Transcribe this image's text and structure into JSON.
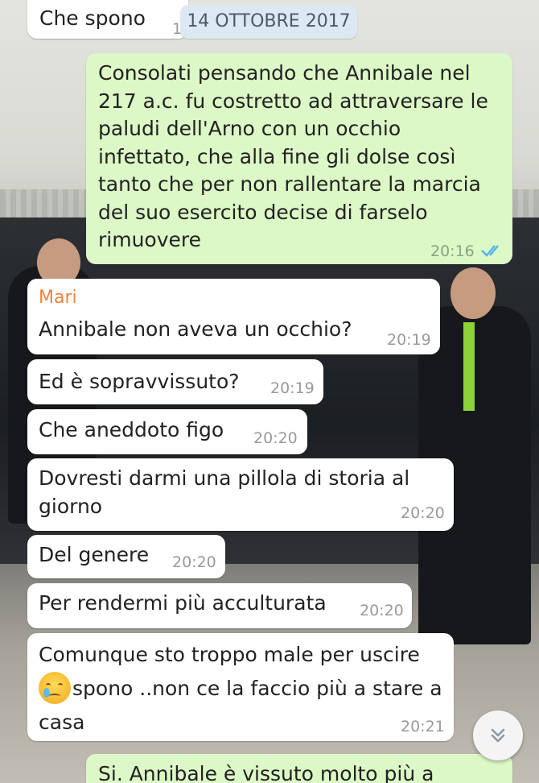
{
  "date_chip": "14 OTTOBRE 2017",
  "messages": [
    {
      "type": "in",
      "text": "Che spono",
      "time": "1"
    },
    {
      "type": "out",
      "text": "Consolati pensando che Annibale nel 217 a.c. fu costretto ad attraversare le paludi dell'Arno con un occhio infettato, che alla fine gli dolse così tanto che per non rallentare la marcia del suo esercito decise di farselo rimuovere",
      "time": "20:16",
      "status": "read-double-check"
    },
    {
      "type": "in",
      "sender": "Mari",
      "text": "Annibale non aveva un occhio?",
      "time": "20:19"
    },
    {
      "type": "in",
      "text": "Ed è sopravvissuto?",
      "time": "20:19"
    },
    {
      "type": "in",
      "text": "Che aneddoto figo",
      "time": "20:20"
    },
    {
      "type": "in",
      "text": "Dovresti darmi una pillola di storia al giorno",
      "time": "20:20"
    },
    {
      "type": "in",
      "text": "Del genere",
      "time": "20:20"
    },
    {
      "type": "in",
      "text": "Per rendermi più acculturata",
      "time": "20:20"
    },
    {
      "type": "in",
      "text_before_emoji": "Comunque sto troppo male per uscire",
      "emoji": "crying-face",
      "text_after_emoji": "spono ..non ce la faccio più a stare a casa",
      "time": "20:21"
    },
    {
      "type": "out",
      "text": "Si. Annibale è vissuto molto più a"
    }
  ],
  "icons": {
    "scroll_down": "chevrons-down-icon",
    "read_receipt": "double-check-icon"
  },
  "colors": {
    "incoming": "#ffffff",
    "outgoing": "#dcf8c6",
    "sender": "#f0823c",
    "read_ticks": "#4fb3e8",
    "date_chip": "#dde9f2"
  }
}
